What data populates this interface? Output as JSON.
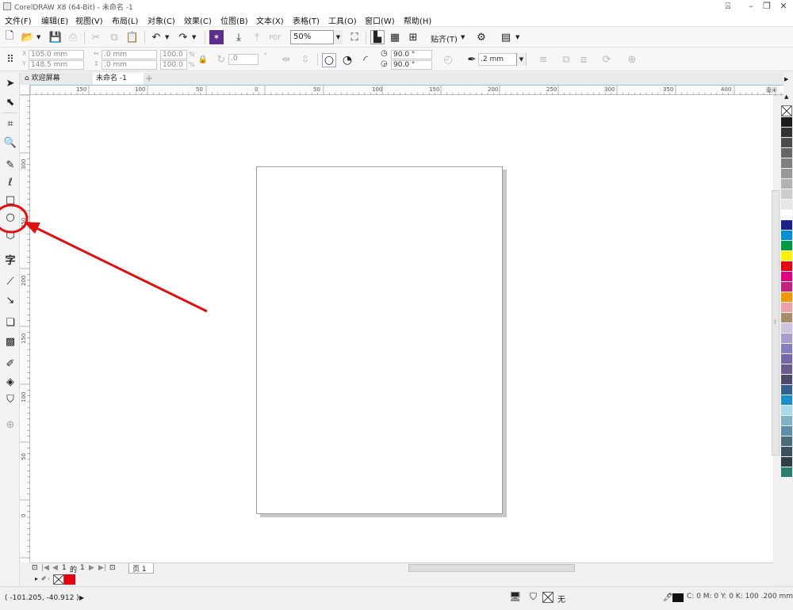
{
  "window": {
    "title": "CorelDRAW X8 (64-Bit) - 未命名 -1"
  },
  "menu": [
    "文件(F)",
    "编辑(E)",
    "视图(V)",
    "布局(L)",
    "对象(C)",
    "效果(C)",
    "位图(B)",
    "文本(X)",
    "表格(T)",
    "工具(O)",
    "窗口(W)",
    "帮助(H)"
  ],
  "standard_toolbar": {
    "zoom": "50%",
    "snap_label": "贴齐(T)"
  },
  "property_bar": {
    "x": "105.0 mm",
    "y": "148.5 mm",
    "width": ".0 mm",
    "height": ".0 mm",
    "scale_w": "100.0",
    "scale_h": "100.0",
    "percent": "%",
    "rotation": ".0",
    "start_angle": "90.0 °",
    "end_angle": "90.0 °",
    "outline_width": ".2 mm"
  },
  "tabs": {
    "welcome": "欢迎屏幕",
    "document": "未命名 -1",
    "add": "+"
  },
  "ruler": {
    "h_labels": [
      "150",
      "100",
      "50",
      "0",
      "50",
      "100",
      "150",
      "200",
      "250",
      "300",
      "350",
      "400"
    ],
    "unit": "毫米",
    "v_labels": [
      "300",
      "250",
      "200",
      "150",
      "100",
      "50",
      "0"
    ]
  },
  "page_nav": {
    "current": "1",
    "of": "的",
    "total": "1",
    "page_tab": "页 1"
  },
  "status": {
    "coords": "( -101.205, -40.912 )",
    "fill_none": "无",
    "outline_info": "C: 0 M: 0 Y: 0 K: 100  .200 mm"
  },
  "palette": [
    "#1a1a1a",
    "#333333",
    "#4d4d4d",
    "#666666",
    "#808080",
    "#999999",
    "#b3b3b3",
    "#cccccc",
    "#e6e6e6",
    "#ffffff",
    "#1d2088",
    "#0090d8",
    "#009a44",
    "#fff100",
    "#e60012",
    "#e4007f",
    "#c1237f",
    "#f39800",
    "#eda1a8",
    "#a88c6d",
    "#cdc4e2",
    "#a99bcd",
    "#8380b8",
    "#7466a8",
    "#6c5c8f",
    "#4c4a6c",
    "#33608f",
    "#1a8fd0",
    "#a8d8ea",
    "#7fb2c8",
    "#5e8ea6",
    "#4b6a7c",
    "#3c4f5c",
    "#2f3e46",
    "#2b7c6e"
  ],
  "colors": {
    "accent_red": "#e01010",
    "ruler_border": "#8cc3df"
  }
}
